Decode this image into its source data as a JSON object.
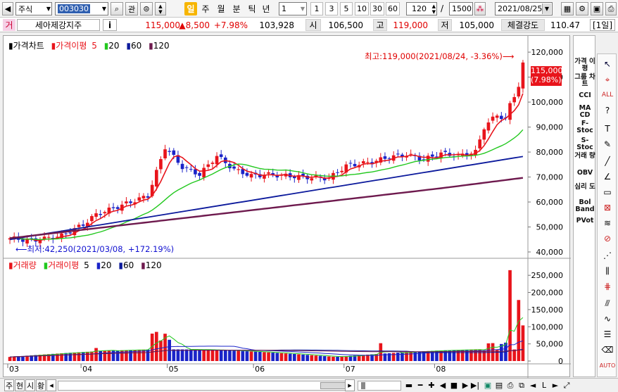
{
  "toolbar": {
    "market_label": "주식",
    "code": "003030",
    "relation_label": "관",
    "periods": [
      "일",
      "주",
      "월",
      "분",
      "틱",
      "년"
    ],
    "active_period": "일",
    "interval_value": "1",
    "interval_presets": [
      "1",
      "3",
      "5",
      "10",
      "30",
      "60"
    ],
    "count_value": "120",
    "count_sep": "/",
    "total_value": "1500",
    "date_value": "2021/08/25"
  },
  "quote": {
    "name_prefix": "거",
    "stock_name": "세아제강지주",
    "info_label": "i",
    "price": "115,000",
    "change": "▲8,500",
    "change_pct": "+7.98%",
    "volume": "103,928",
    "open_label": "시",
    "open": "106,500",
    "high_label": "고",
    "high": "119,000",
    "low_label": "저",
    "low": "105,000",
    "strength_label": "체결강도",
    "strength": "110.47",
    "period_badge": "[1일]"
  },
  "price_legend": {
    "candle": "가격차트",
    "ma_title": "가격이평",
    "ma": [
      "5",
      "20",
      "60",
      "120"
    ]
  },
  "volume_legend": {
    "vol": "거래량",
    "ma_title": "거래이평",
    "ma": [
      "5",
      "20",
      "60",
      "120"
    ]
  },
  "annotations": {
    "high_note": "최고:119,000(2021/08/24, -3.36%)⟶",
    "low_note": "⟵최저:42,250(2021/03/08, +172.19%)",
    "last_price": "115,000",
    "last_pct": "(7.98%)"
  },
  "indicators": [
    "가격 이평",
    "그룹 차트",
    "CCI",
    "MA CD",
    "F- Stoc",
    "S- Stoc",
    "거래 량",
    "OBV",
    "심리 도",
    "Bol Band",
    "PVot"
  ],
  "bottom": {
    "tabs": [
      "주",
      "현",
      "시",
      "황"
    ]
  },
  "colors": {
    "up": "#e8141b",
    "down": "#1a23c8",
    "ma5": "#e8141b",
    "ma20": "#22c81e",
    "ma60": "#0c1a9c",
    "ma120": "#6e1a4e"
  },
  "chart_data": {
    "type": "candlestick",
    "x_ticks": [
      "03",
      "04",
      "05",
      "06",
      "07",
      "08"
    ],
    "price_axis": {
      "ticks": [
        "120,000",
        "110,000",
        "100,000",
        "90,000",
        "80,000",
        "70,000",
        "60,000",
        "50,000",
        "40,000"
      ],
      "ylim": [
        40000,
        122000
      ]
    },
    "volume_axis": {
      "ticks": [
        "250,000",
        "200,000",
        "150,000",
        "100,000",
        "50,000",
        "0"
      ],
      "ylim": [
        0,
        275000
      ]
    },
    "volume_highlights": [
      {
        "date": "2021/08/20",
        "value": 265000
      },
      {
        "date": "2021/08/24",
        "value": 178000
      },
      {
        "date": "2021/08/25",
        "value": 103928
      }
    ]
  }
}
